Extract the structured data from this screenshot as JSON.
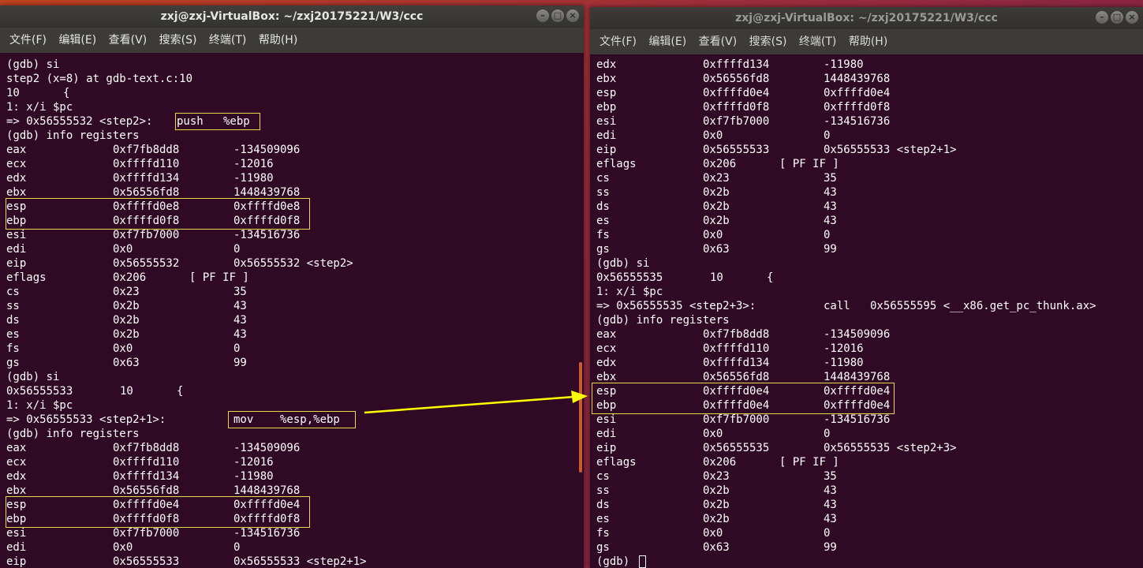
{
  "menu": [
    "文件(F)",
    "编辑(E)",
    "查看(V)",
    "搜索(S)",
    "终端(T)",
    "帮助(H)"
  ],
  "window_left": {
    "title": "zxj@zxj-VirtualBox: ~/zxj20175221/W3/ccc",
    "lines": [
      [
        "(gdb) si"
      ],
      [
        "step2 (x=8) at gdb-text.c:10"
      ],
      [
        "10",
        "{"
      ],
      [
        "1: x/i $pc"
      ],
      [
        "=> 0x56555532 <step2>:",
        "push   %ebp"
      ],
      [
        "(gdb) info registers"
      ],
      [
        "eax",
        "0xf7fb8dd8",
        "-134509096"
      ],
      [
        "ecx",
        "0xffffd110",
        "-12016"
      ],
      [
        "edx",
        "0xffffd134",
        "-11980"
      ],
      [
        "ebx",
        "0x56556fd8",
        "1448439768"
      ],
      [
        "esp",
        "0xffffd0e8",
        "0xffffd0e8"
      ],
      [
        "ebp",
        "0xffffd0f8",
        "0xffffd0f8"
      ],
      [
        "esi",
        "0xf7fb7000",
        "-134516736"
      ],
      [
        "edi",
        "0x0",
        "0"
      ],
      [
        "eip",
        "0x56555532",
        "0x56555532 <step2>"
      ],
      [
        "eflags",
        "0x206",
        "[ PF IF ]"
      ],
      [
        "cs",
        "0x23",
        "35"
      ],
      [
        "ss",
        "0x2b",
        "43"
      ],
      [
        "ds",
        "0x2b",
        "43"
      ],
      [
        "es",
        "0x2b",
        "43"
      ],
      [
        "fs",
        "0x0",
        "0"
      ],
      [
        "gs",
        "0x63",
        "99"
      ],
      [
        "(gdb) si"
      ],
      [
        "0x56555533",
        "10",
        "{"
      ],
      [
        "1: x/i $pc"
      ],
      [
        "=> 0x56555533 <step2+1>:",
        "mov    %esp,%ebp"
      ],
      [
        "(gdb) info registers"
      ],
      [
        "eax",
        "0xf7fb8dd8",
        "-134509096"
      ],
      [
        "ecx",
        "0xffffd110",
        "-12016"
      ],
      [
        "edx",
        "0xffffd134",
        "-11980"
      ],
      [
        "ebx",
        "0x56556fd8",
        "1448439768"
      ],
      [
        "esp",
        "0xffffd0e4",
        "0xffffd0e4"
      ],
      [
        "ebp",
        "0xffffd0f8",
        "0xffffd0f8"
      ],
      [
        "esi",
        "0xf7fb7000",
        "-134516736"
      ],
      [
        "edi",
        "0x0",
        "0"
      ],
      [
        "eip",
        "0x56555533",
        "0x56555533 <step2+1>"
      ]
    ]
  },
  "window_right": {
    "title": "zxj@zxj-VirtualBox: ~/zxj20175221/W3/ccc",
    "lines": [
      [
        "edx",
        "0xffffd134",
        "-11980"
      ],
      [
        "ebx",
        "0x56556fd8",
        "1448439768"
      ],
      [
        "esp",
        "0xffffd0e4",
        "0xffffd0e4"
      ],
      [
        "ebp",
        "0xffffd0f8",
        "0xffffd0f8"
      ],
      [
        "esi",
        "0xf7fb7000",
        "-134516736"
      ],
      [
        "edi",
        "0x0",
        "0"
      ],
      [
        "eip",
        "0x56555533",
        "0x56555533 <step2+1>"
      ],
      [
        "eflags",
        "0x206",
        "[ PF IF ]"
      ],
      [
        "cs",
        "0x23",
        "35"
      ],
      [
        "ss",
        "0x2b",
        "43"
      ],
      [
        "ds",
        "0x2b",
        "43"
      ],
      [
        "es",
        "0x2b",
        "43"
      ],
      [
        "fs",
        "0x0",
        "0"
      ],
      [
        "gs",
        "0x63",
        "99"
      ],
      [
        "(gdb) si"
      ],
      [
        "0x56555535",
        "10",
        "{"
      ],
      [
        "1: x/i $pc"
      ],
      [
        "=> 0x56555535 <step2+3>:",
        "call   0x56555595 <__x86.get_pc_thunk.ax>"
      ],
      [
        "(gdb) info registers"
      ],
      [
        "eax",
        "0xf7fb8dd8",
        "-134509096"
      ],
      [
        "ecx",
        "0xffffd110",
        "-12016"
      ],
      [
        "edx",
        "0xffffd134",
        "-11980"
      ],
      [
        "ebx",
        "0x56556fd8",
        "1448439768"
      ],
      [
        "esp",
        "0xffffd0e4",
        "0xffffd0e4"
      ],
      [
        "ebp",
        "0xffffd0e4",
        "0xffffd0e4"
      ],
      [
        "esi",
        "0xf7fb7000",
        "-134516736"
      ],
      [
        "edi",
        "0x0",
        "0"
      ],
      [
        "eip",
        "0x56555535",
        "0x56555535 <step2+3>"
      ],
      [
        "eflags",
        "0x206",
        "[ PF IF ]"
      ],
      [
        "cs",
        "0x23",
        "35"
      ],
      [
        "ss",
        "0x2b",
        "43"
      ],
      [
        "ds",
        "0x2b",
        "43"
      ],
      [
        "es",
        "0x2b",
        "43"
      ],
      [
        "fs",
        "0x0",
        "0"
      ],
      [
        "gs",
        "0x63",
        "99"
      ],
      [
        "(gdb)"
      ]
    ]
  },
  "colors": {
    "terminal_bg": "#300a24",
    "highlight": "#e8d84c",
    "arrow": "#ffff00"
  }
}
